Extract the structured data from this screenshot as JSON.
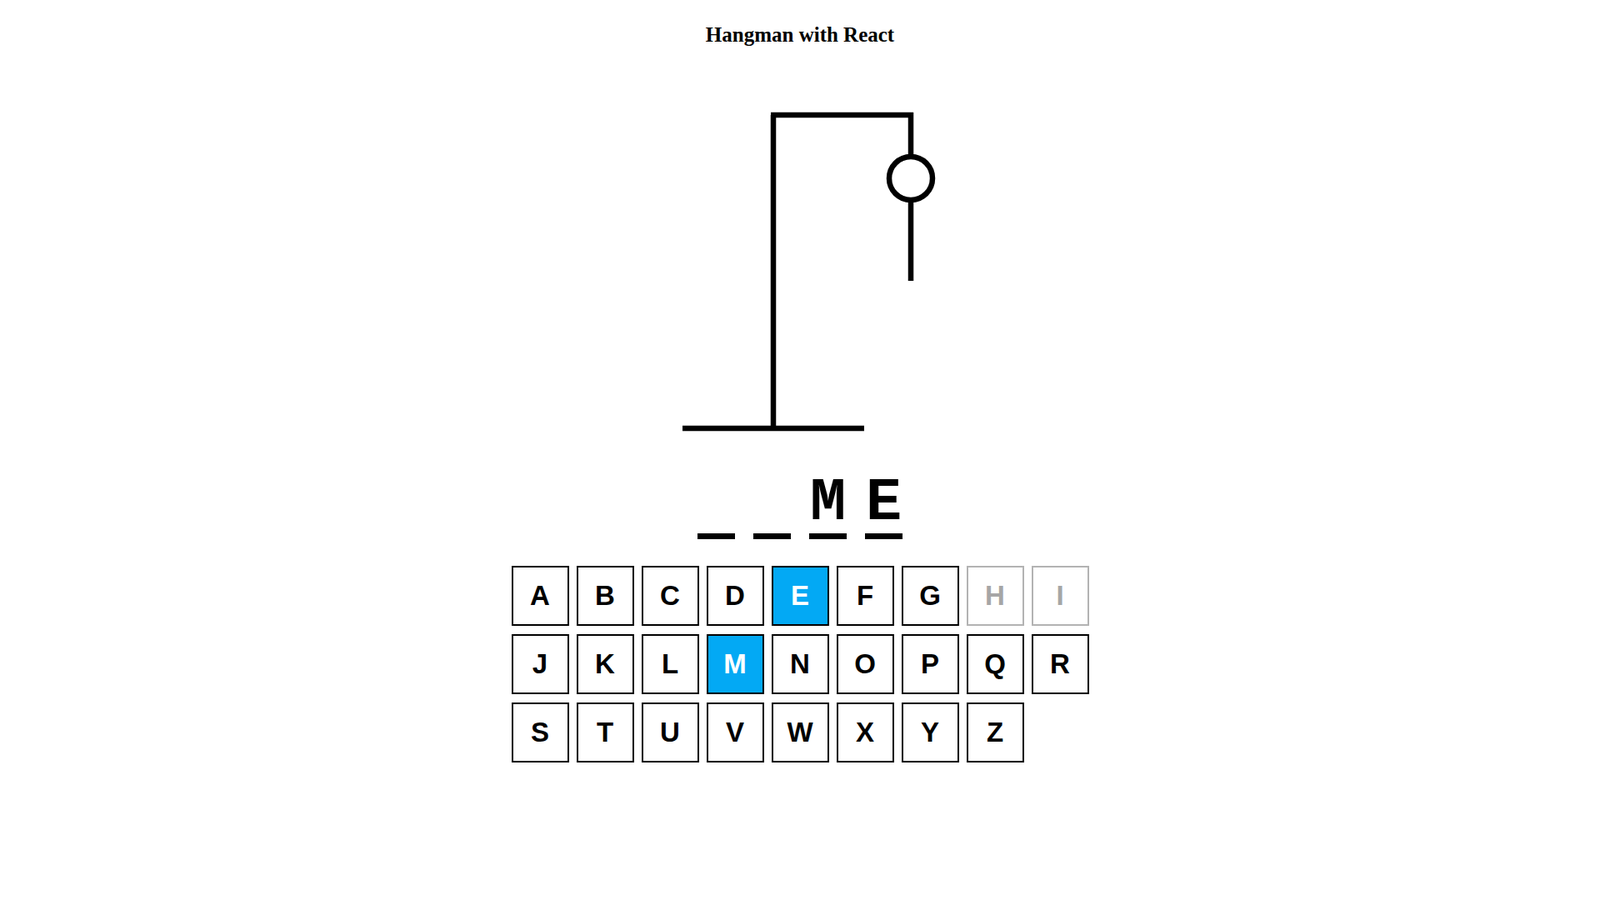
{
  "title": "Hangman with React",
  "figure": {
    "parts": [
      {
        "kind": "head",
        "shown": true
      },
      {
        "kind": "body",
        "shown": true
      },
      {
        "kind": "right-arm",
        "shown": false
      },
      {
        "kind": "left-arm",
        "shown": false
      },
      {
        "kind": "right-leg",
        "shown": false
      },
      {
        "kind": "left-leg",
        "shown": false
      }
    ]
  },
  "word": [
    {
      "revealed": false
    },
    {
      "revealed": false
    },
    {
      "char": "M",
      "revealed": true
    },
    {
      "char": "E",
      "revealed": true
    }
  ],
  "keyboard": [
    {
      "label": "A",
      "selected": false,
      "disabled": false
    },
    {
      "label": "B",
      "selected": false,
      "disabled": false
    },
    {
      "label": "C",
      "selected": false,
      "disabled": false
    },
    {
      "label": "D",
      "selected": false,
      "disabled": false
    },
    {
      "label": "E",
      "selected": true,
      "disabled": false
    },
    {
      "label": "F",
      "selected": false,
      "disabled": false
    },
    {
      "label": "G",
      "selected": false,
      "disabled": false
    },
    {
      "label": "H",
      "selected": false,
      "disabled": true
    },
    {
      "label": "I",
      "selected": false,
      "disabled": true
    },
    {
      "label": "J",
      "selected": false,
      "disabled": false
    },
    {
      "label": "K",
      "selected": false,
      "disabled": false
    },
    {
      "label": "L",
      "selected": false,
      "disabled": false
    },
    {
      "label": "M",
      "selected": true,
      "disabled": false
    },
    {
      "label": "N",
      "selected": false,
      "disabled": false
    },
    {
      "label": "O",
      "selected": false,
      "disabled": false
    },
    {
      "label": "P",
      "selected": false,
      "disabled": false
    },
    {
      "label": "Q",
      "selected": false,
      "disabled": false
    },
    {
      "label": "R",
      "selected": false,
      "disabled": false
    },
    {
      "label": "S",
      "selected": false,
      "disabled": false
    },
    {
      "label": "T",
      "selected": false,
      "disabled": false
    },
    {
      "label": "U",
      "selected": false,
      "disabled": false
    },
    {
      "label": "V",
      "selected": false,
      "disabled": false
    },
    {
      "label": "W",
      "selected": false,
      "disabled": false
    },
    {
      "label": "X",
      "selected": false,
      "disabled": false
    },
    {
      "label": "Y",
      "selected": false,
      "disabled": false
    },
    {
      "label": "Z",
      "selected": false,
      "disabled": false
    }
  ]
}
